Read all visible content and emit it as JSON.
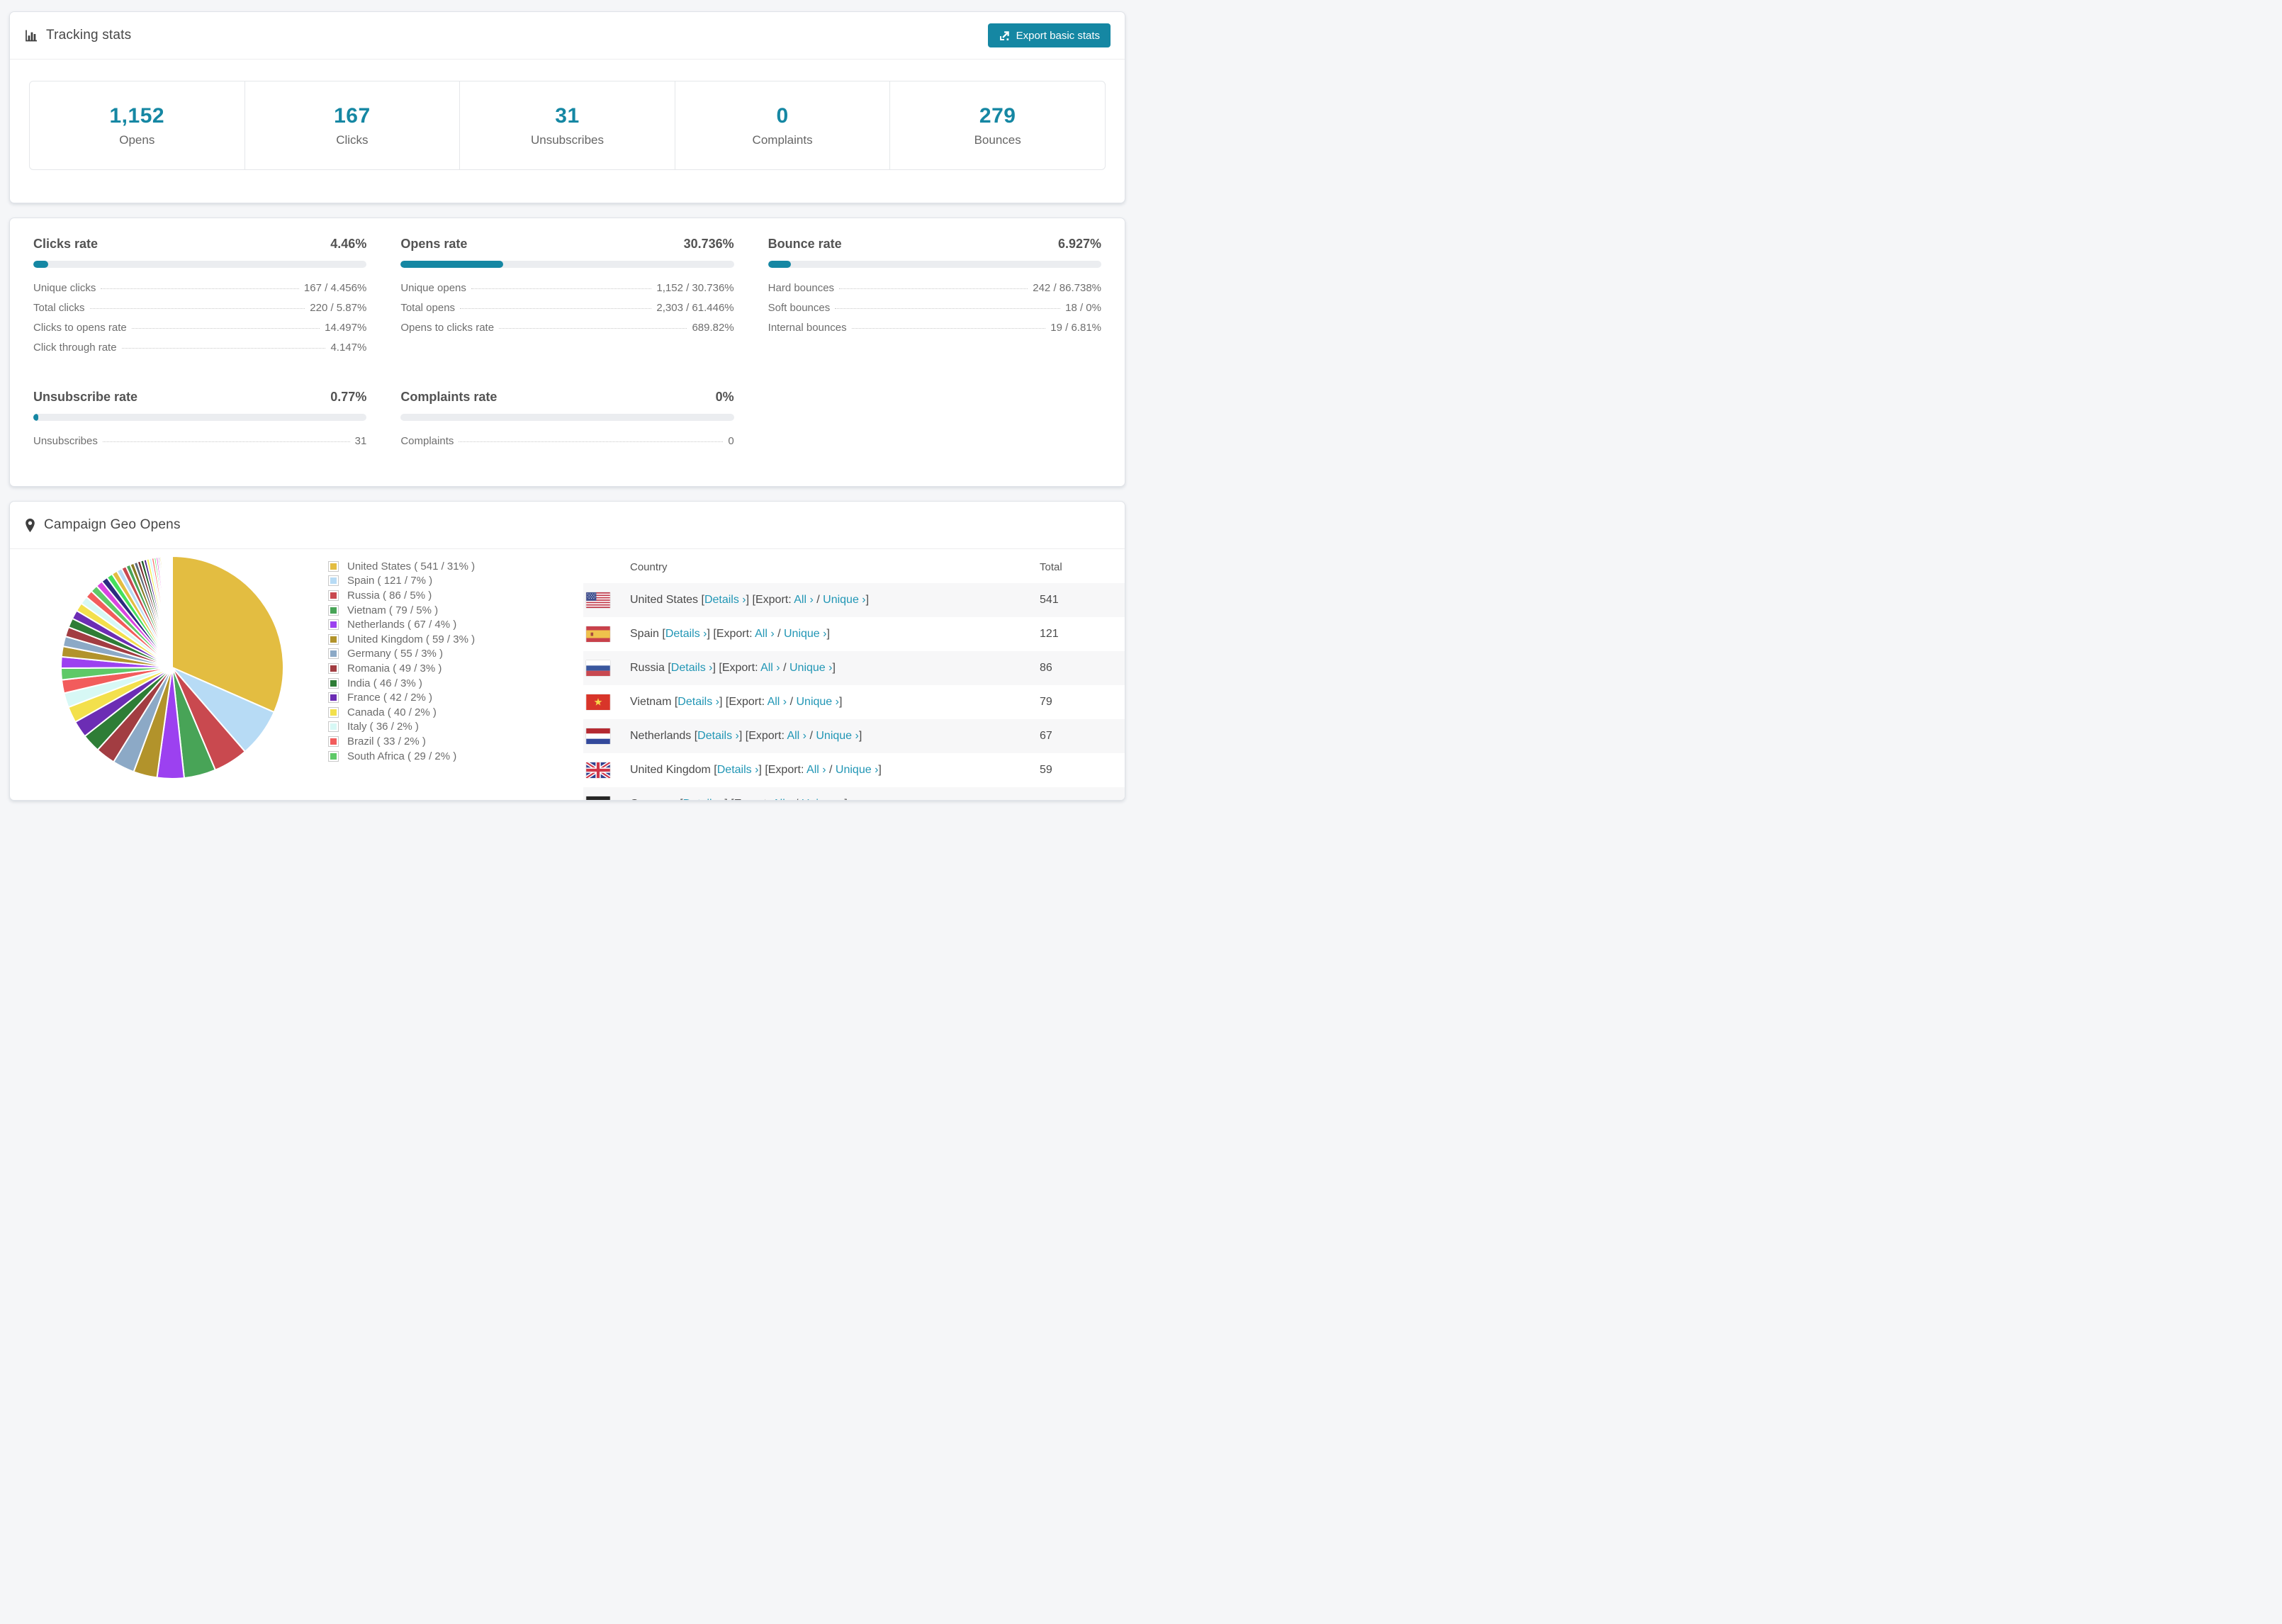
{
  "accent_color": "#1587a3",
  "link_color": "#2196b5",
  "tracking": {
    "title": "Tracking stats",
    "export_label": "Export basic stats"
  },
  "stats": [
    {
      "value": "1,152",
      "label": "Opens"
    },
    {
      "value": "167",
      "label": "Clicks"
    },
    {
      "value": "31",
      "label": "Unsubscribes"
    },
    {
      "value": "0",
      "label": "Complaints"
    },
    {
      "value": "279",
      "label": "Bounces"
    }
  ],
  "rates": [
    {
      "title": "Clicks rate",
      "value": "4.46%",
      "fill_percent": 4.46,
      "rows": [
        {
          "label": "Unique clicks",
          "value": "167 / 4.456%"
        },
        {
          "label": "Total clicks",
          "value": "220 / 5.87%"
        },
        {
          "label": "Clicks to opens rate",
          "value": "14.497%"
        },
        {
          "label": "Click through rate",
          "value": "4.147%"
        }
      ]
    },
    {
      "title": "Opens rate",
      "value": "30.736%",
      "fill_percent": 30.736,
      "rows": [
        {
          "label": "Unique opens",
          "value": "1,152 / 30.736%"
        },
        {
          "label": "Total opens",
          "value": "2,303 / 61.446%"
        },
        {
          "label": "Opens to clicks rate",
          "value": "689.82%"
        }
      ]
    },
    {
      "title": "Bounce rate",
      "value": "6.927%",
      "fill_percent": 6.927,
      "rows": [
        {
          "label": "Hard bounces",
          "value": "242 / 86.738%"
        },
        {
          "label": "Soft bounces",
          "value": "18 / 0%"
        },
        {
          "label": "Internal bounces",
          "value": "19 / 6.81%"
        }
      ]
    },
    {
      "title": "Unsubscribe rate",
      "value": "0.77%",
      "fill_percent": 0.77,
      "rows": [
        {
          "label": "Unsubscribes",
          "value": "31"
        }
      ]
    },
    {
      "title": "Complaints rate",
      "value": "0%",
      "fill_percent": 0,
      "rows": [
        {
          "label": "Complaints",
          "value": "0"
        }
      ]
    }
  ],
  "geo": {
    "title": "Campaign Geo Opens",
    "link_labels": {
      "details": "Details ›",
      "export_prefix": " [Export: ",
      "all": "All ›",
      "separator": " / ",
      "unique": "Unique ›",
      "open_bracket": " [",
      "close_bracket": "]"
    },
    "table": {
      "columns": [
        "Country",
        "Total"
      ],
      "rows": [
        {
          "flag": "us",
          "country": "United States",
          "total": "541"
        },
        {
          "flag": "es",
          "country": "Spain",
          "total": "121"
        },
        {
          "flag": "ru",
          "country": "Russia",
          "total": "86"
        },
        {
          "flag": "vn",
          "country": "Vietnam",
          "total": "79"
        },
        {
          "flag": "nl",
          "country": "Netherlands",
          "total": "67"
        },
        {
          "flag": "gb",
          "country": "United Kingdom",
          "total": "59"
        }
      ],
      "partial_row": {
        "flag": "de",
        "country": "Germany",
        "total": ""
      }
    }
  },
  "chart_data": {
    "type": "pie",
    "title": "Campaign Geo Opens",
    "legend_position": "right",
    "series": [
      {
        "name": "United States",
        "value": 541,
        "percent": 31,
        "label": "United States ( 541 / 31% )",
        "color": "#e3bd41"
      },
      {
        "name": "Spain",
        "value": 121,
        "percent": 7,
        "label": "Spain ( 121 / 7% )",
        "color": "#b7dbf5"
      },
      {
        "name": "Russia",
        "value": 86,
        "percent": 5,
        "label": "Russia ( 86 / 5% )",
        "color": "#c9494f"
      },
      {
        "name": "Vietnam",
        "value": 79,
        "percent": 5,
        "label": "Vietnam ( 79 / 5% )",
        "color": "#48a457"
      },
      {
        "name": "Netherlands",
        "value": 67,
        "percent": 4,
        "label": "Netherlands ( 67 / 4% )",
        "color": "#9c41f0"
      },
      {
        "name": "United Kingdom",
        "value": 59,
        "percent": 3,
        "label": "United Kingdom ( 59 / 3% )",
        "color": "#b2932b"
      },
      {
        "name": "Germany",
        "value": 55,
        "percent": 3,
        "label": "Germany ( 55 / 3% )",
        "color": "#8ca9c6"
      },
      {
        "name": "Romania",
        "value": 49,
        "percent": 3,
        "label": "Romania ( 49 / 3% )",
        "color": "#a23d42"
      },
      {
        "name": "India",
        "value": 46,
        "percent": 3,
        "label": "India ( 46 / 3% )",
        "color": "#2e7d36"
      },
      {
        "name": "France",
        "value": 42,
        "percent": 2,
        "label": "France ( 42 / 2% )",
        "color": "#6c2db4"
      },
      {
        "name": "Canada",
        "value": 40,
        "percent": 2,
        "label": "Canada ( 40 / 2% )",
        "color": "#f3e04c"
      },
      {
        "name": "Italy",
        "value": 36,
        "percent": 2,
        "label": "Italy ( 36 / 2% )",
        "color": "#d7f8f5"
      },
      {
        "name": "Brazil",
        "value": 33,
        "percent": 2,
        "label": "Brazil ( 33 / 2% )",
        "color": "#f25c5c"
      },
      {
        "name": "South Africa",
        "value": 29,
        "percent": 2,
        "label": "South Africa ( 29 / 2% )",
        "color": "#5ec967"
      }
    ],
    "others_estimated_values": [
      28,
      26,
      25,
      24,
      23,
      22,
      21,
      20,
      19,
      18,
      17,
      16,
      15,
      14,
      13,
      12,
      11,
      10,
      9,
      8,
      8,
      7,
      7,
      6,
      6,
      5,
      5,
      4,
      4,
      3,
      3,
      3,
      2,
      2,
      2,
      2,
      1,
      1,
      1,
      1,
      1,
      1,
      1,
      1,
      0.5,
      0.5,
      0.5,
      0.5
    ],
    "others_palette": [
      "#9c41f0",
      "#b2932b",
      "#8ca9c6",
      "#a23d42",
      "#2e7d36",
      "#6c2db4",
      "#f3e04c",
      "#d7f8f5",
      "#f25c5c",
      "#5ec967",
      "#d944e0",
      "#2c2a80",
      "#45e05c",
      "#e3bd41",
      "#b7dbf5",
      "#c9494f",
      "#48a457",
      "#8a7a24",
      "#5a6b7a",
      "#7a2d31",
      "#1f5c28",
      "#4b1f8a",
      "#f5ef55",
      "#c4f2ff",
      "#ff6b6b",
      "#57e06b",
      "#e044d0",
      "#2d2a7a",
      "#d4c431",
      "#8fd9ff"
    ]
  }
}
